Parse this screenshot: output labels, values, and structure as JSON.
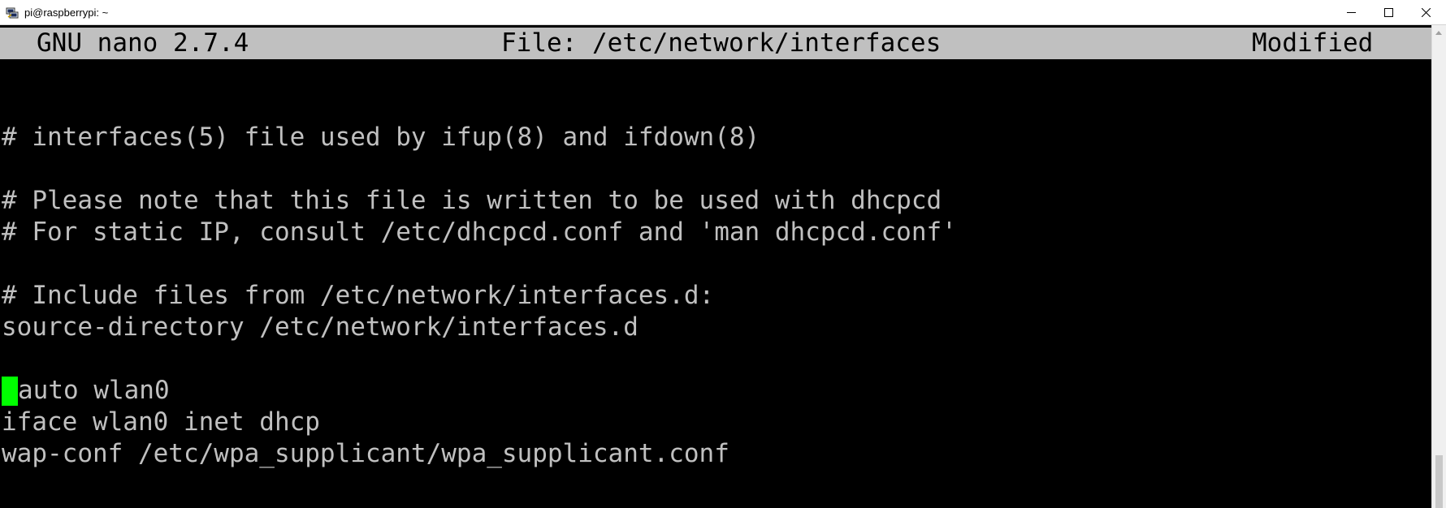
{
  "window": {
    "title": "pi@raspberrypi: ~",
    "app_icon": "putty-icon",
    "buttons": {
      "minimize": "minimize-icon",
      "maximize": "maximize-icon",
      "close": "close-icon"
    }
  },
  "nano": {
    "version": "GNU nano 2.7.4",
    "file_label": "File: /etc/network/interfaces",
    "status": "Modified"
  },
  "editor": {
    "lines": [
      "",
      "# interfaces(5) file used by ifup(8) and ifdown(8)",
      "",
      "# Please note that this file is written to be used with dhcpcd",
      "# For static IP, consult /etc/dhcpcd.conf and 'man dhcpcd.conf'",
      "",
      "# Include files from /etc/network/interfaces.d:",
      "source-directory /etc/network/interfaces.d",
      "",
      "auto wlan0",
      "iface wlan0 inet dhcp",
      "wap-conf /etc/wpa_supplicant/wpa_supplicant.conf"
    ],
    "cursor_line": 9,
    "cursor_column": 0
  },
  "colors": {
    "terminal_bg": "#000000",
    "text": "#c0c0c0",
    "header_bg": "#c0c0c0",
    "cursor": "#00ff00"
  }
}
